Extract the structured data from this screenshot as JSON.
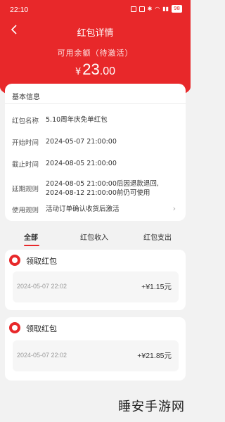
{
  "status_bar": {
    "time": "22:10",
    "battery": "98"
  },
  "header": {
    "title": "红包详情",
    "balance_label": "可用余额（待激活）",
    "currency": "¥",
    "balance_int": "23",
    "balance_dec": ".00",
    "accent_color": "#e8282a"
  },
  "info": {
    "heading": "基本信息",
    "rows": [
      {
        "key": "红包名称",
        "value": "5.10周年庆免单红包"
      },
      {
        "key": "开始时间",
        "value": "2024-05-07 21:00:00"
      },
      {
        "key": "截止时间",
        "value": "2024-08-05 21:00:00"
      },
      {
        "key": "延期规则",
        "value_line1": "2024-08-05 21:00:00后因退款退回,",
        "value_line2": "2024-08-12 21:00:00前仍可使用"
      },
      {
        "key": "使用规则",
        "value": "活动订单确认收货后激活"
      }
    ],
    "chevron": "›"
  },
  "tabs": [
    {
      "label": "全部",
      "active": true
    },
    {
      "label": "红包收入",
      "active": false
    },
    {
      "label": "红包支出",
      "active": false
    }
  ],
  "records": [
    {
      "title": "领取红包",
      "date": "2024-05-07 22:02",
      "amount": "+¥1.15元"
    },
    {
      "title": "领取红包",
      "date": "2024-05-07 22:02",
      "amount": "+¥21.85元"
    }
  ],
  "watermark": "睡安手游网"
}
